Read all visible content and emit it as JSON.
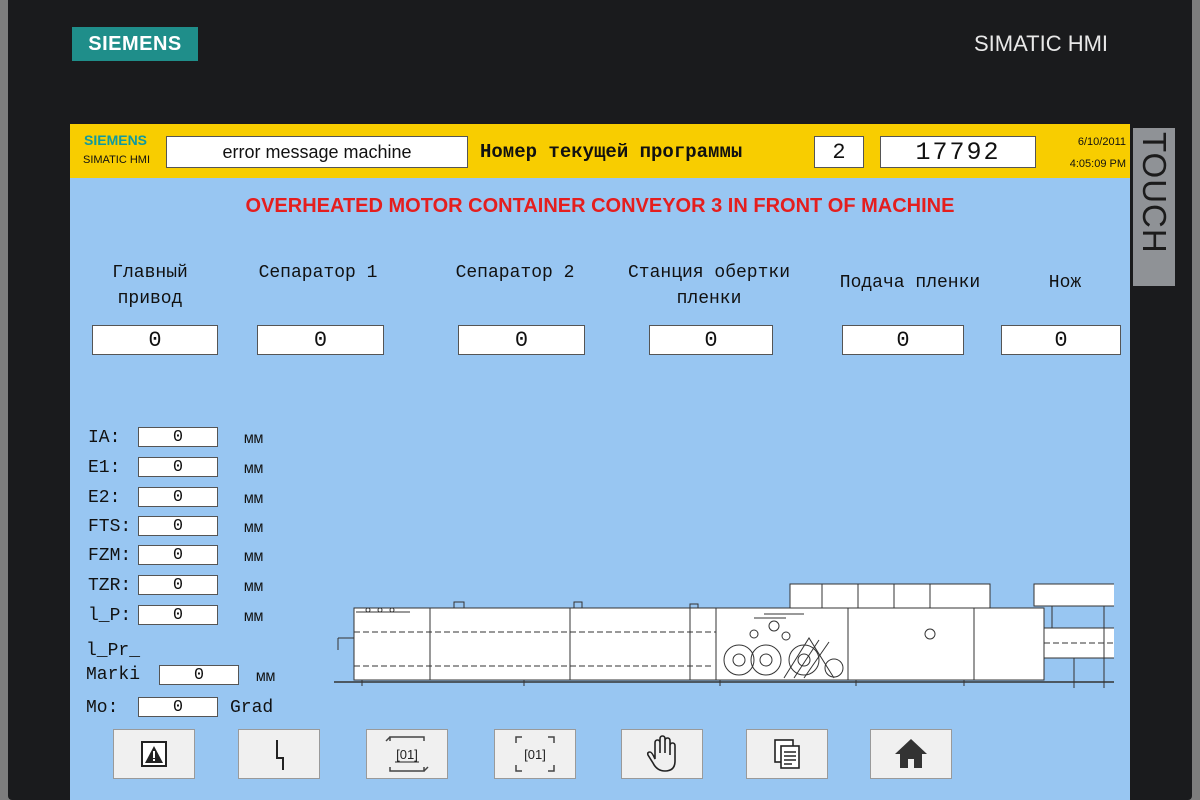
{
  "device": {
    "brand": "SIEMENS",
    "model": "SIMATIC HMI",
    "touch_label": "TOUCH"
  },
  "header": {
    "brand": "SIEMENS",
    "sub": "SIMATIC HMI",
    "message_field": "error message machine",
    "program_label": "Номер текущей программы",
    "program_number": "2",
    "counter": "17792",
    "date": "6/10/2011",
    "time": "4:05:09 PM"
  },
  "alarm": "OVERHEATED MOTOR CONTAINER CONVEYOR 3 IN FRONT OF MACHINE",
  "drives": [
    {
      "label": "Главный\nпривод",
      "value": "0"
    },
    {
      "label": "Сепаратор 1",
      "value": "0"
    },
    {
      "label": "Сепаратор 2",
      "value": "0"
    },
    {
      "label": "Станция обертки\nпленки",
      "value": "0"
    },
    {
      "label": "Подача пленки",
      "value": "0"
    },
    {
      "label": "Нож",
      "value": "0"
    }
  ],
  "params": [
    {
      "label": "IA:",
      "value": "0",
      "unit": "мм"
    },
    {
      "label": "E1:",
      "value": "0",
      "unit": "мм"
    },
    {
      "label": "E2:",
      "value": "0",
      "unit": "мм"
    },
    {
      "label": "FTS:",
      "value": "0",
      "unit": "мм"
    },
    {
      "label": "FZM:",
      "value": "0",
      "unit": "мм"
    },
    {
      "label": "TZR:",
      "value": "0",
      "unit": "мм"
    },
    {
      "label": "l_P:",
      "value": "0",
      "unit": "мм"
    },
    {
      "label": "l_Pr_\nMarki",
      "value": "0",
      "unit": "мм"
    },
    {
      "label": "Mo:",
      "value": "0",
      "unit": "Grad"
    }
  ],
  "toolbar": [
    {
      "icon": "warning-icon"
    },
    {
      "icon": "lightning-icon"
    },
    {
      "icon": "counter-reset-icon",
      "text": "[01]"
    },
    {
      "icon": "counter-rotate-icon",
      "text": "[01]"
    },
    {
      "icon": "hand-stop-icon"
    },
    {
      "icon": "documents-icon"
    },
    {
      "icon": "home-icon"
    }
  ],
  "colors": {
    "screen_bg": "#98c6f2",
    "header_bg": "#f8cd00",
    "alarm_text": "#e41e1e",
    "logo_bg": "#1f8e8a"
  }
}
